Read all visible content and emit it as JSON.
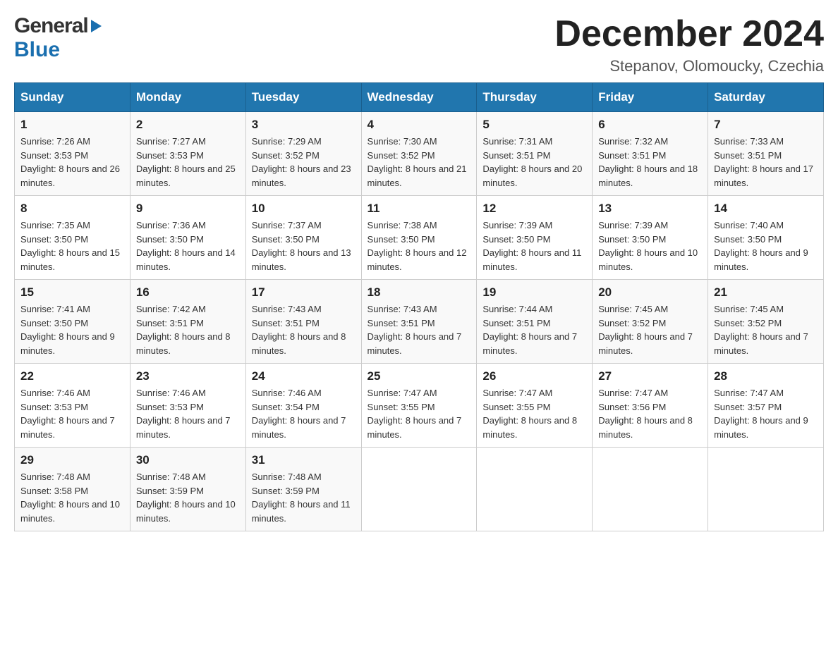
{
  "logo": {
    "general": "General",
    "blue": "Blue"
  },
  "header": {
    "title": "December 2024",
    "subtitle": "Stepanov, Olomoucky, Czechia"
  },
  "days_of_week": [
    "Sunday",
    "Monday",
    "Tuesday",
    "Wednesday",
    "Thursday",
    "Friday",
    "Saturday"
  ],
  "weeks": [
    [
      {
        "num": "1",
        "sunrise": "7:26 AM",
        "sunset": "3:53 PM",
        "daylight": "8 hours and 26 minutes."
      },
      {
        "num": "2",
        "sunrise": "7:27 AM",
        "sunset": "3:53 PM",
        "daylight": "8 hours and 25 minutes."
      },
      {
        "num": "3",
        "sunrise": "7:29 AM",
        "sunset": "3:52 PM",
        "daylight": "8 hours and 23 minutes."
      },
      {
        "num": "4",
        "sunrise": "7:30 AM",
        "sunset": "3:52 PM",
        "daylight": "8 hours and 21 minutes."
      },
      {
        "num": "5",
        "sunrise": "7:31 AM",
        "sunset": "3:51 PM",
        "daylight": "8 hours and 20 minutes."
      },
      {
        "num": "6",
        "sunrise": "7:32 AM",
        "sunset": "3:51 PM",
        "daylight": "8 hours and 18 minutes."
      },
      {
        "num": "7",
        "sunrise": "7:33 AM",
        "sunset": "3:51 PM",
        "daylight": "8 hours and 17 minutes."
      }
    ],
    [
      {
        "num": "8",
        "sunrise": "7:35 AM",
        "sunset": "3:50 PM",
        "daylight": "8 hours and 15 minutes."
      },
      {
        "num": "9",
        "sunrise": "7:36 AM",
        "sunset": "3:50 PM",
        "daylight": "8 hours and 14 minutes."
      },
      {
        "num": "10",
        "sunrise": "7:37 AM",
        "sunset": "3:50 PM",
        "daylight": "8 hours and 13 minutes."
      },
      {
        "num": "11",
        "sunrise": "7:38 AM",
        "sunset": "3:50 PM",
        "daylight": "8 hours and 12 minutes."
      },
      {
        "num": "12",
        "sunrise": "7:39 AM",
        "sunset": "3:50 PM",
        "daylight": "8 hours and 11 minutes."
      },
      {
        "num": "13",
        "sunrise": "7:39 AM",
        "sunset": "3:50 PM",
        "daylight": "8 hours and 10 minutes."
      },
      {
        "num": "14",
        "sunrise": "7:40 AM",
        "sunset": "3:50 PM",
        "daylight": "8 hours and 9 minutes."
      }
    ],
    [
      {
        "num": "15",
        "sunrise": "7:41 AM",
        "sunset": "3:50 PM",
        "daylight": "8 hours and 9 minutes."
      },
      {
        "num": "16",
        "sunrise": "7:42 AM",
        "sunset": "3:51 PM",
        "daylight": "8 hours and 8 minutes."
      },
      {
        "num": "17",
        "sunrise": "7:43 AM",
        "sunset": "3:51 PM",
        "daylight": "8 hours and 8 minutes."
      },
      {
        "num": "18",
        "sunrise": "7:43 AM",
        "sunset": "3:51 PM",
        "daylight": "8 hours and 7 minutes."
      },
      {
        "num": "19",
        "sunrise": "7:44 AM",
        "sunset": "3:51 PM",
        "daylight": "8 hours and 7 minutes."
      },
      {
        "num": "20",
        "sunrise": "7:45 AM",
        "sunset": "3:52 PM",
        "daylight": "8 hours and 7 minutes."
      },
      {
        "num": "21",
        "sunrise": "7:45 AM",
        "sunset": "3:52 PM",
        "daylight": "8 hours and 7 minutes."
      }
    ],
    [
      {
        "num": "22",
        "sunrise": "7:46 AM",
        "sunset": "3:53 PM",
        "daylight": "8 hours and 7 minutes."
      },
      {
        "num": "23",
        "sunrise": "7:46 AM",
        "sunset": "3:53 PM",
        "daylight": "8 hours and 7 minutes."
      },
      {
        "num": "24",
        "sunrise": "7:46 AM",
        "sunset": "3:54 PM",
        "daylight": "8 hours and 7 minutes."
      },
      {
        "num": "25",
        "sunrise": "7:47 AM",
        "sunset": "3:55 PM",
        "daylight": "8 hours and 7 minutes."
      },
      {
        "num": "26",
        "sunrise": "7:47 AM",
        "sunset": "3:55 PM",
        "daylight": "8 hours and 8 minutes."
      },
      {
        "num": "27",
        "sunrise": "7:47 AM",
        "sunset": "3:56 PM",
        "daylight": "8 hours and 8 minutes."
      },
      {
        "num": "28",
        "sunrise": "7:47 AM",
        "sunset": "3:57 PM",
        "daylight": "8 hours and 9 minutes."
      }
    ],
    [
      {
        "num": "29",
        "sunrise": "7:48 AM",
        "sunset": "3:58 PM",
        "daylight": "8 hours and 10 minutes."
      },
      {
        "num": "30",
        "sunrise": "7:48 AM",
        "sunset": "3:59 PM",
        "daylight": "8 hours and 10 minutes."
      },
      {
        "num": "31",
        "sunrise": "7:48 AM",
        "sunset": "3:59 PM",
        "daylight": "8 hours and 11 minutes."
      },
      null,
      null,
      null,
      null
    ]
  ],
  "labels": {
    "sunrise_prefix": "Sunrise: ",
    "sunset_prefix": "Sunset: ",
    "daylight_prefix": "Daylight: "
  }
}
